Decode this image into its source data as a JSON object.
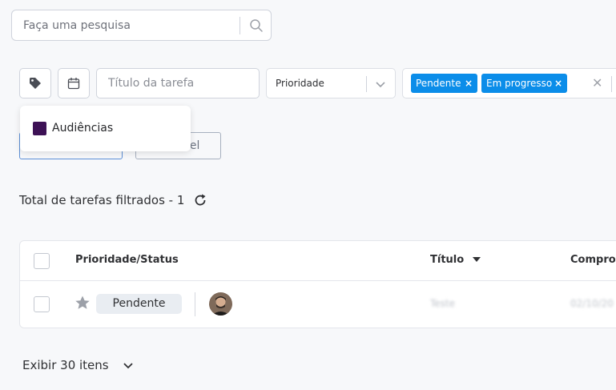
{
  "search": {
    "placeholder": "Faça uma pesquisa"
  },
  "filters": {
    "title_placeholder": "Título da tarefa",
    "priority_select": "Prioridade",
    "status_tags": [
      "Pendente",
      "Em progresso"
    ],
    "tag_remove_glyph": "×",
    "clear_glyph": "✕"
  },
  "tag_dropdown": {
    "items": [
      {
        "label": "Audiências",
        "color": "#3d1155"
      }
    ]
  },
  "buttons": {
    "partial_right_label": "nel"
  },
  "summary": {
    "total_text": "Total de tarefas filtrados - 1"
  },
  "table": {
    "columns": [
      "Prioridade/Status",
      "Título",
      "Compron"
    ],
    "rows": [
      {
        "status": "Pendente",
        "title": "Teste",
        "date": "02/10/20"
      }
    ]
  },
  "pagination": {
    "show_label": "Exibir 30 itens"
  },
  "colors": {
    "accent": "#0b8de9",
    "tag_color": "#3d1155"
  }
}
